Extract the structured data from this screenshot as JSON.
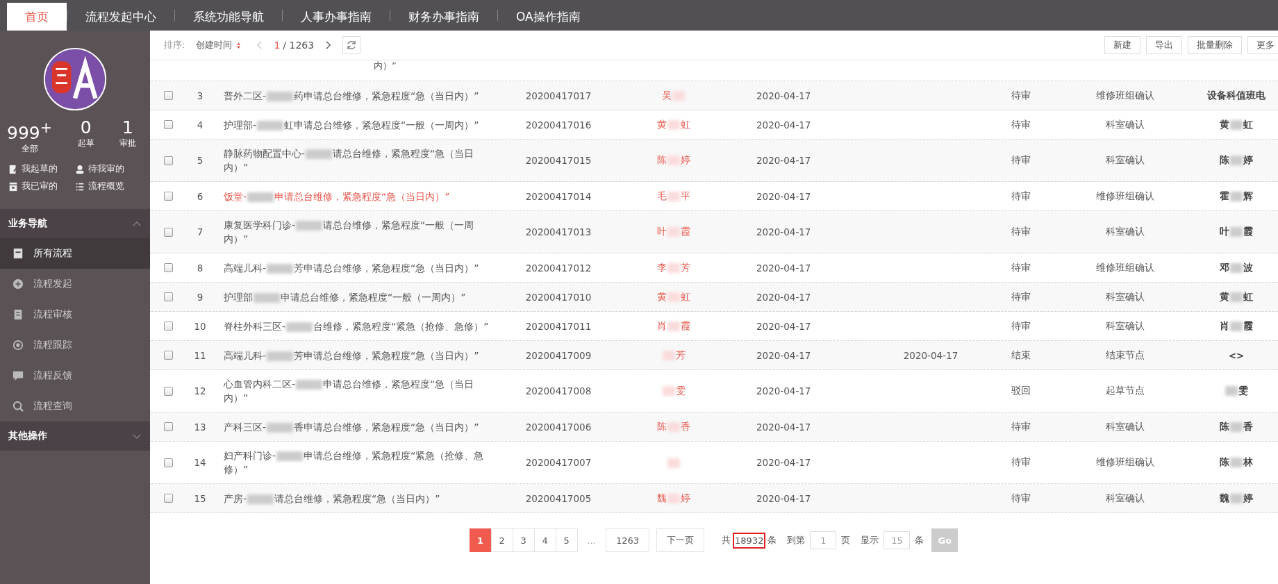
{
  "top_nav": [
    {
      "label": "首页",
      "selected": true
    },
    {
      "label": "流程发起中心",
      "selected": false
    },
    {
      "label": "系统功能导航",
      "selected": false
    },
    {
      "label": "人事办事指南",
      "selected": false
    },
    {
      "label": "财务办事指南",
      "selected": false
    },
    {
      "label": "OA操作指南",
      "selected": false
    }
  ],
  "sidebar": {
    "stats": [
      {
        "value": "999$^{+}$",
        "label": "全部"
      },
      {
        "value": "0",
        "label": "起草"
      },
      {
        "value": "1",
        "label": "审批"
      }
    ],
    "quick_links": [
      {
        "kind": "draft",
        "label": "我起草的"
      },
      {
        "kind": "person",
        "label": "待我审的"
      },
      {
        "kind": "box",
        "label": "我已审的"
      },
      {
        "kind": "list",
        "label": "流程概览"
      }
    ],
    "sections": [
      {
        "title": "业务导航",
        "expanded": true,
        "items": [
          {
            "kind": "archive",
            "label": "所有流程",
            "selected": true
          },
          {
            "kind": "plus",
            "label": "流程发起",
            "selected": false
          },
          {
            "kind": "doc",
            "label": "流程审核",
            "selected": false
          },
          {
            "kind": "target",
            "label": "流程跟踪",
            "selected": false
          },
          {
            "kind": "chat",
            "label": "流程反馈",
            "selected": false
          },
          {
            "kind": "search",
            "label": "流程查询",
            "selected": false
          }
        ]
      },
      {
        "title": "其他操作",
        "expanded": false
      }
    ]
  },
  "toolbar": {
    "sort_label": "排序:",
    "sort_field": "创建时间",
    "prev_disabled": true,
    "page_current": "1",
    "page_total": "/ 1263",
    "buttons": [
      "新建",
      "导出",
      "批量删除",
      "更多"
    ]
  },
  "table": {
    "partial_row_fragment": "内）”",
    "rows": [
      {
        "checked": false,
        "selected": false,
        "number": "3",
        "title": [
          {
            "kind": "text",
            "text": "普外二区-"
          },
          {
            "kind": "blur"
          },
          {
            "kind": "text",
            "text": "药申请总台维修，紧急程度“急（当日内）”"
          }
        ],
        "id": "20200417017",
        "applicant": [
          {
            "kind": "text",
            "text": "吴"
          },
          {
            "kind": "blur"
          }
        ],
        "created": "2020-04-17",
        "status": "待审",
        "node": "维修班组确认",
        "handler": [
          {
            "kind": "text",
            "text": "设备科值班电"
          }
        ]
      },
      {
        "checked": false,
        "selected": false,
        "number": "4",
        "title": [
          {
            "kind": "text",
            "text": "护理部-"
          },
          {
            "kind": "blur"
          },
          {
            "kind": "text",
            "text": "虹申请总台维修，紧急程度“一般（一周内）”"
          }
        ],
        "id": "20200417016",
        "applicant": [
          {
            "kind": "text",
            "text": "黄"
          },
          {
            "kind": "blur"
          },
          {
            "kind": "text",
            "text": "虹"
          }
        ],
        "created": "2020-04-17",
        "status": "待审",
        "node": "科室确认",
        "handler": [
          {
            "kind": "text",
            "text": "黄"
          },
          {
            "kind": "blur"
          },
          {
            "kind": "text",
            "text": "虹"
          }
        ]
      },
      {
        "checked": false,
        "selected": false,
        "number": "5",
        "title": [
          {
            "kind": "text",
            "text": "静脉药物配置中心-"
          },
          {
            "kind": "blur"
          },
          {
            "kind": "text",
            "text": "请总台维修，紧急程度“急（当日内）”"
          }
        ],
        "id": "20200417015",
        "applicant": [
          {
            "kind": "text",
            "text": "陈"
          },
          {
            "kind": "blur"
          },
          {
            "kind": "text",
            "text": "婷"
          }
        ],
        "created": "2020-04-17",
        "status": "待审",
        "node": "科室确认",
        "handler": [
          {
            "kind": "text",
            "text": "陈"
          },
          {
            "kind": "blur"
          },
          {
            "kind": "text",
            "text": "婷"
          }
        ]
      },
      {
        "checked": false,
        "selected": true,
        "number": "6",
        "title": [
          {
            "kind": "text",
            "text": "饭堂-"
          },
          {
            "kind": "blur"
          },
          {
            "kind": "text",
            "text": "申请总台维修，紧急程度“急（当日内）”"
          }
        ],
        "id": "20200417014",
        "applicant": [
          {
            "kind": "text",
            "text": "毛"
          },
          {
            "kind": "blur"
          },
          {
            "kind": "text",
            "text": "平"
          }
        ],
        "created": "2020-04-17",
        "status": "待审",
        "node": "维修班组确认",
        "handler": [
          {
            "kind": "text",
            "text": "霍"
          },
          {
            "kind": "blur"
          },
          {
            "kind": "text",
            "text": "辉"
          }
        ]
      },
      {
        "checked": false,
        "selected": false,
        "number": "7",
        "title": [
          {
            "kind": "text",
            "text": "康复医学科门诊-"
          },
          {
            "kind": "blur"
          },
          {
            "kind": "text",
            "text": "请总台维修，紧急程度“一般（一周内）”"
          }
        ],
        "id": "20200417013",
        "applicant": [
          {
            "kind": "text",
            "text": "叶"
          },
          {
            "kind": "blur"
          },
          {
            "kind": "text",
            "text": "霞"
          }
        ],
        "created": "2020-04-17",
        "status": "待审",
        "node": "科室确认",
        "handler": [
          {
            "kind": "text",
            "text": "叶"
          },
          {
            "kind": "blur"
          },
          {
            "kind": "text",
            "text": "霞"
          }
        ]
      },
      {
        "checked": false,
        "selected": false,
        "number": "8",
        "title": [
          {
            "kind": "text",
            "text": "高端儿科-"
          },
          {
            "kind": "blur"
          },
          {
            "kind": "text",
            "text": "芳申请总台维修，紧急程度“急（当日内）”"
          }
        ],
        "id": "20200417012",
        "applicant": [
          {
            "kind": "text",
            "text": "李"
          },
          {
            "kind": "blur"
          },
          {
            "kind": "text",
            "text": "芳"
          }
        ],
        "created": "2020-04-17",
        "status": "待审",
        "node": "维修班组确认",
        "handler": [
          {
            "kind": "text",
            "text": "邓"
          },
          {
            "kind": "blur"
          },
          {
            "kind": "text",
            "text": "波"
          }
        ]
      },
      {
        "checked": false,
        "selected": false,
        "number": "9",
        "title": [
          {
            "kind": "text",
            "text": "护理部"
          },
          {
            "kind": "blur"
          },
          {
            "kind": "text",
            "text": "申请总台维修，紧急程度“一般（一周内）”"
          }
        ],
        "id": "20200417010",
        "applicant": [
          {
            "kind": "text",
            "text": "黄"
          },
          {
            "kind": "blur"
          },
          {
            "kind": "text",
            "text": "虹"
          }
        ],
        "created": "2020-04-17",
        "status": "待审",
        "node": "科室确认",
        "handler": [
          {
            "kind": "text",
            "text": "黄"
          },
          {
            "kind": "blur"
          },
          {
            "kind": "text",
            "text": "虹"
          }
        ]
      },
      {
        "checked": false,
        "selected": false,
        "number": "10",
        "title": [
          {
            "kind": "text",
            "text": "脊柱外科三区-"
          },
          {
            "kind": "blur"
          },
          {
            "kind": "text",
            "text": "台维修，紧急程度“紧急（抢修、急修）”"
          }
        ],
        "id": "20200417011",
        "applicant": [
          {
            "kind": "text",
            "text": "肖"
          },
          {
            "kind": "blur"
          },
          {
            "kind": "text",
            "text": "霞"
          }
        ],
        "created": "2020-04-17",
        "status": "待审",
        "node": "科室确认",
        "handler": [
          {
            "kind": "text",
            "text": "肖"
          },
          {
            "kind": "blur"
          },
          {
            "kind": "text",
            "text": "霞"
          }
        ]
      },
      {
        "checked": false,
        "selected": false,
        "number": "11",
        "title": [
          {
            "kind": "text",
            "text": "高端儿科-"
          },
          {
            "kind": "blur"
          },
          {
            "kind": "text",
            "text": "芳申请总台维修，紧急程度“急（当日内）”"
          }
        ],
        "id": "20200417009",
        "applicant": [
          {
            "kind": "blur"
          },
          {
            "kind": "text",
            "text": "芳"
          }
        ],
        "created": "2020-04-17",
        "finished": "2020-04-17",
        "status": "结束",
        "node": "结束节点",
        "handler": [
          {
            "kind": "text",
            "text": "<>"
          }
        ]
      },
      {
        "checked": false,
        "selected": false,
        "number": "12",
        "title": [
          {
            "kind": "text",
            "text": "心血管内科二区-"
          },
          {
            "kind": "blur"
          },
          {
            "kind": "text",
            "text": "申请总台维修，紧急程度“急（当日内）”"
          }
        ],
        "id": "20200417008",
        "applicant": [
          {
            "kind": "blur"
          },
          {
            "kind": "text",
            "text": "雯"
          }
        ],
        "created": "2020-04-17",
        "status": "驳回",
        "node": "起草节点",
        "handler": [
          {
            "kind": "blur"
          },
          {
            "kind": "text",
            "text": "雯"
          }
        ]
      },
      {
        "checked": false,
        "selected": false,
        "number": "13",
        "title": [
          {
            "kind": "text",
            "text": "产科三区-"
          },
          {
            "kind": "blur"
          },
          {
            "kind": "text",
            "text": "香申请总台维修，紧急程度“急（当日内）”"
          }
        ],
        "id": "20200417006",
        "applicant": [
          {
            "kind": "text",
            "text": "陈"
          },
          {
            "kind": "blur"
          },
          {
            "kind": "text",
            "text": "香"
          }
        ],
        "created": "2020-04-17",
        "status": "待审",
        "node": "科室确认",
        "handler": [
          {
            "kind": "text",
            "text": "陈"
          },
          {
            "kind": "blur"
          },
          {
            "kind": "text",
            "text": "香"
          }
        ]
      },
      {
        "checked": false,
        "selected": false,
        "number": "14",
        "title": [
          {
            "kind": "text",
            "text": "妇产科门诊-"
          },
          {
            "kind": "blur"
          },
          {
            "kind": "text",
            "text": "申请总台维修，紧急程度“紧急（抢修、急修）”"
          }
        ],
        "id": "20200417007",
        "applicant": [
          {
            "kind": "blur"
          }
        ],
        "created": "2020-04-17",
        "status": "待审",
        "node": "维修班组确认",
        "handler": [
          {
            "kind": "text",
            "text": "陈"
          },
          {
            "kind": "blur"
          },
          {
            "kind": "text",
            "text": "林"
          }
        ]
      },
      {
        "checked": false,
        "selected": false,
        "number": "15",
        "title": [
          {
            "kind": "text",
            "text": "产房-"
          },
          {
            "kind": "blur"
          },
          {
            "kind": "text",
            "text": "请总台维修，紧急程度“急（当日内）”"
          }
        ],
        "id": "20200417005",
        "applicant": [
          {
            "kind": "text",
            "text": "魏"
          },
          {
            "kind": "blur"
          },
          {
            "kind": "text",
            "text": "婷"
          }
        ],
        "created": "2020-04-17",
        "status": "待审",
        "node": "科室确认",
        "handler": [
          {
            "kind": "text",
            "text": "魏"
          },
          {
            "kind": "blur"
          },
          {
            "kind": "text",
            "text": "婷"
          }
        ]
      }
    ]
  },
  "pagination": {
    "pages": [
      {
        "label": "1",
        "selected": true
      },
      {
        "label": "2",
        "selected": false
      },
      {
        "label": "3",
        "selected": false
      },
      {
        "label": "4",
        "selected": false
      },
      {
        "label": "5",
        "selected": false
      }
    ],
    "ellipsis": "...",
    "last_page": "1263",
    "next": "下一页",
    "total_prefix": "共",
    "total": "18932",
    "total_suffix": "条",
    "goto_prefix": "到第",
    "goto_value": "1",
    "goto_suffix": "页",
    "size_prefix": "显示",
    "size_value": "15",
    "size_suffix": "条",
    "go": "Go",
    "go_disabled": true
  }
}
